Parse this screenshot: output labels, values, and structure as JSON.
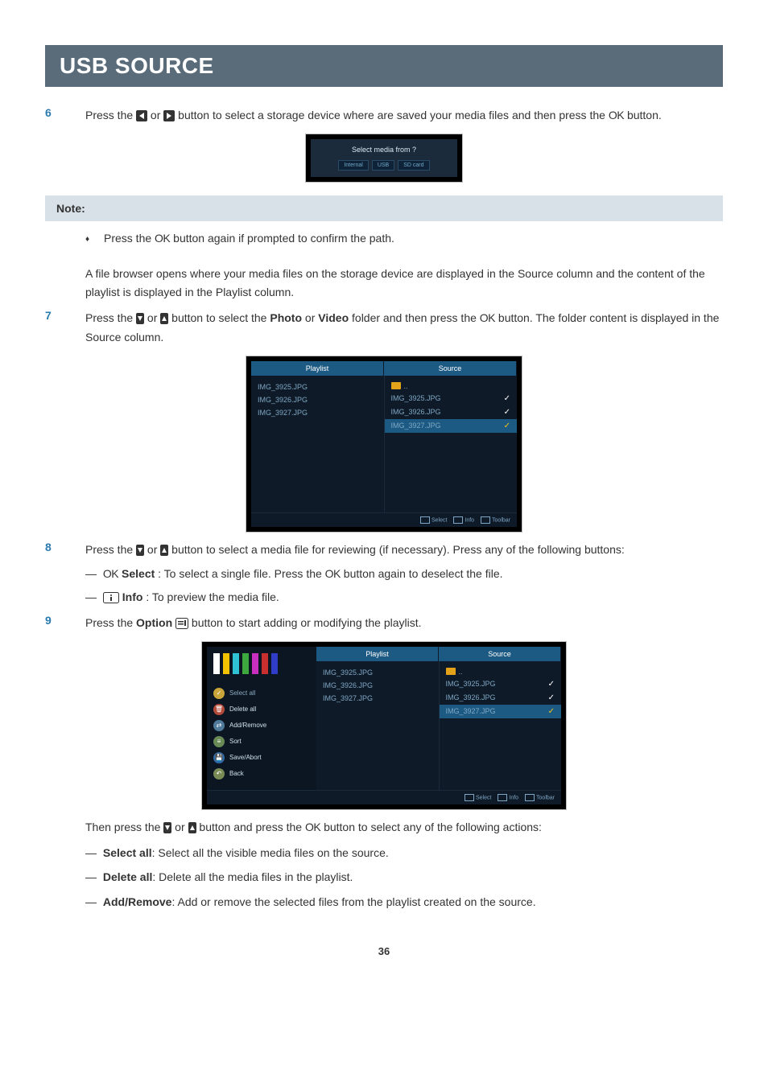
{
  "heading": "USB SOURCE",
  "steps": {
    "s6": {
      "num": "6",
      "t1": "Press the ",
      "t2": " or ",
      "t3": " button to select a storage device where are saved your media files and then press the ",
      "ok": "OK",
      "t4": " button."
    },
    "s7": {
      "num": "7",
      "t1": "Press the ",
      "t2": " or ",
      "t3": " button to select the ",
      "b1": "Photo",
      "t4": " or ",
      "b2": "Video",
      "t5": " folder and then press the ",
      "ok": "OK",
      "t6": " button. The folder content is displayed in the Source column."
    },
    "s8": {
      "num": "8",
      "t1": "Press the ",
      "t2": " or ",
      "t3": " button to select a media file for reviewing (if necessary). Press any of the following buttons:",
      "l1a": "OK",
      "l1b": " Select",
      "l1c": ": To select a single file. Press the ",
      "l1d": "OK",
      "l1e": " button again to deselect the file.",
      "l2a": "Info",
      "l2b": ": To preview the media file."
    },
    "s9": {
      "num": "9",
      "t1": "Press the ",
      "b1": "Option",
      "t2": " button to start adding or modifying the playlist."
    }
  },
  "note": {
    "header": "Note:",
    "bullet": "Press the ",
    "ok": "OK",
    "bullet2": " button again if prompted to confirm the path."
  },
  "para1": "A file browser opens where your media files on the storage device are displayed in the Source column and the content of the playlist is displayed in the Playlist column.",
  "after9": {
    "t1": "Then press the ",
    "t2": " or ",
    "t3": " button and press the ",
    "ok": "OK",
    "t4": " button to select any of the following actions:",
    "a1b": "Select all",
    "a1t": ": Select all the visible media files on the source.",
    "a2b": "Delete all",
    "a2t": ": Delete all the media files in the playlist.",
    "a3b": "Add/Remove",
    "a3t": ": Add or remove the selected files from the playlist created on the source."
  },
  "dlg": {
    "title": "Select media from ?",
    "tabs": [
      "Internal",
      "USB",
      "SD card"
    ]
  },
  "pls": {
    "headPlaylist": "Playlist",
    "headSource": "Source",
    "playlist": [
      "IMG_3925.JPG",
      "IMG_3926.JPG",
      "IMG_3927.JPG"
    ],
    "folderLabel": "..",
    "source": [
      "IMG_3925.JPG",
      "IMG_3926.JPG",
      "IMG_3927.JPG"
    ],
    "footer": {
      "select": "Select",
      "info": "Info",
      "toolbar": "Toolbar"
    }
  },
  "opt": {
    "menu": [
      {
        "label": "Select all",
        "color": "#c9a43a"
      },
      {
        "label": "Delete all",
        "color": "#b44b3a"
      },
      {
        "label": "Add/Remove",
        "color": "#4f7a9a"
      },
      {
        "label": "Sort",
        "color": "#6a8a55"
      },
      {
        "label": "Save/Abort",
        "color": "#2f6aa8"
      },
      {
        "label": "Back",
        "color": "#7a8a55"
      }
    ]
  },
  "pageNum": "36"
}
